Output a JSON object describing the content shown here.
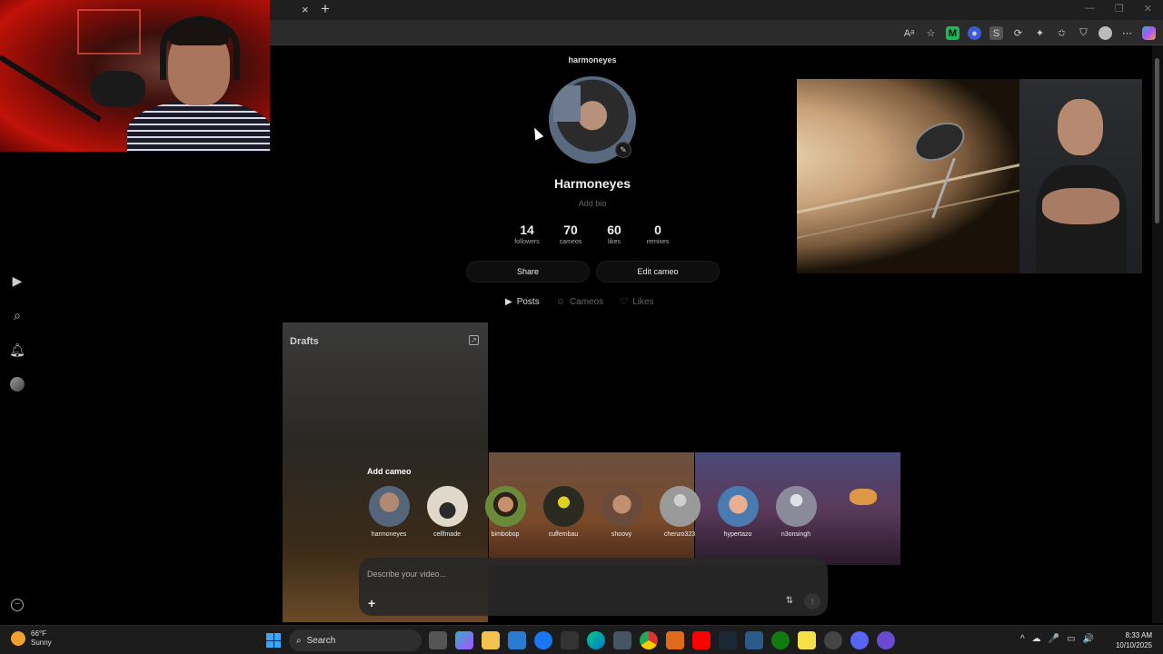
{
  "browser": {
    "tab_close": "×",
    "tab_new": "+",
    "window_controls": [
      "—",
      "❐",
      "✕"
    ],
    "toolbar_icons": [
      "read-aloud-icon",
      "favorite-star-icon",
      "extension-m-icon",
      "extension-dot-icon",
      "extension-s-icon",
      "refresh-icon",
      "extension-icon",
      "favorites-icon",
      "shield-icon",
      "profile-icon",
      "more-icon",
      "copilot-icon"
    ]
  },
  "profile": {
    "username_header": "harmoneyes",
    "display_name": "Harmoneyes",
    "bio_placeholder": "Add bio",
    "stats": [
      {
        "value": "14",
        "label": "followers"
      },
      {
        "value": "70",
        "label": "cameos"
      },
      {
        "value": "60",
        "label": "likes"
      },
      {
        "value": "0",
        "label": "remixes"
      }
    ],
    "share_label": "Share",
    "edit_cameo_label": "Edit cameo",
    "tabs": [
      {
        "label": "Posts",
        "icon": "▶",
        "active": true
      },
      {
        "label": "Cameos",
        "icon": "☺",
        "active": false
      },
      {
        "label": "Likes",
        "icon": "♡",
        "active": false
      }
    ]
  },
  "drafts": {
    "label": "Drafts"
  },
  "composer": {
    "add_cameo_title": "Add cameo",
    "cameos": [
      {
        "name": "harmoneyes",
        "color": "#7a8aa0"
      },
      {
        "name": "cellfmade",
        "color": "#d8d0c0"
      },
      {
        "name": "bimbobop",
        "color": "#5a7a3a"
      },
      {
        "name": "cuffembau",
        "color": "#2a2a20"
      },
      {
        "name": "shoovy",
        "color": "#a07050"
      },
      {
        "name": "chenzo323",
        "color": "#9a9a9a"
      },
      {
        "name": "hypertazo",
        "color": "#4a7ab0"
      },
      {
        "name": "n3onsingh",
        "color": "#8a8a9a"
      }
    ],
    "placeholder": "Describe your video...",
    "plus_label": "+",
    "settings_icon": "⇅",
    "send_icon": "↑"
  },
  "left_nav": [
    "play-icon",
    "search-icon",
    "bell-icon",
    "avatar"
  ],
  "taskbar": {
    "temperature": "66°F",
    "condition": "Sunny",
    "search_label": "Search",
    "time": "8:33 AM",
    "date": "10/10/2025",
    "tray_icons": [
      "^",
      "☁",
      "🎤",
      "▭",
      "🔊"
    ]
  }
}
